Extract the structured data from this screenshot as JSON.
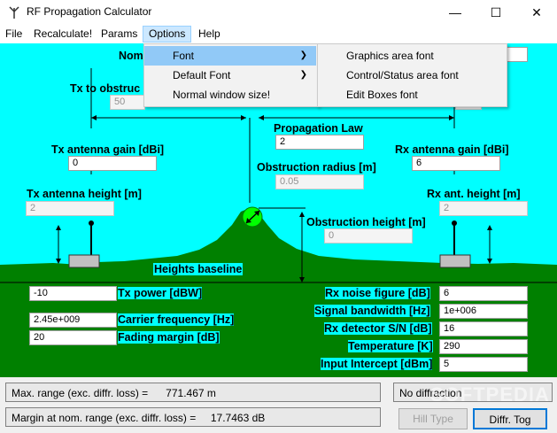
{
  "window": {
    "title": "RF Propagation Calculator"
  },
  "menu": {
    "file": "File",
    "recalc": "Recalculate!",
    "params": "Params",
    "options": "Options",
    "help": "Help"
  },
  "options_menu": {
    "font": "Font",
    "default_font": "Default Font",
    "normal_size": "Normal window size!"
  },
  "font_submenu": {
    "graphics": "Graphics area font",
    "control": "Control/Status area font",
    "edit": "Edit Boxes font"
  },
  "labels": {
    "nom_trunc": "Nom",
    "tx_obstruction_trunc": "Tx to obstruc",
    "propagation_law": "Propagation Law",
    "tx_antenna_gain": "Tx antenna gain [dBi]",
    "rx_antenna_gain": "Rx antenna gain [dBi]",
    "obstruction_radius": "Obstruction radius [m]",
    "tx_antenna_height": "Tx antenna height [m]",
    "rx_antenna_height": "Rx ant. height [m]",
    "obstruction_height": "Obstruction height [m]",
    "heights_baseline": "Heights baseline",
    "tx_power": "Tx power [dBW]",
    "carrier_frequency": "Carrier frequency [Hz]",
    "fading_margin": "Fading margin [dB]",
    "rx_noise_figure": "Rx noise figure [dB]",
    "signal_bandwidth": "Signal bandwidth [Hz]",
    "rx_detector_sn": "Rx detector S/N [dB]",
    "temperature": "Temperature [K]",
    "input_intercept": "Input Intercept [dBm]"
  },
  "values": {
    "tx_obstruction": "50",
    "propagation_law": "2",
    "tx_antenna_gain": "0",
    "rx_antenna_gain": "6",
    "obstruction_radius": "0.05",
    "tx_antenna_height": "2",
    "rx_antenna_height": "2",
    "obstruction_height": "0",
    "tx_power": "-10",
    "carrier_frequency": "2.45e+009",
    "fading_margin": "20",
    "rx_noise_figure": "6",
    "signal_bandwidth": "1e+006",
    "rx_detector_sn": "16",
    "temperature": "290",
    "input_intercept": "5"
  },
  "status": {
    "max_range": "Max. range (exc. diffr. loss) =      771.467 m",
    "margin": "Margin at nom. range (exc. diffr. loss) =     17.7463 dB",
    "diffraction": "No diffraction"
  },
  "buttons": {
    "hill_type": "Hill Type",
    "diffr_tog": "Diffr. Tog"
  },
  "watermark": "SOFTPEDIA",
  "colors": {
    "sky": "#00ffff",
    "ground": "#008000",
    "obstruction": "#00ff00"
  }
}
